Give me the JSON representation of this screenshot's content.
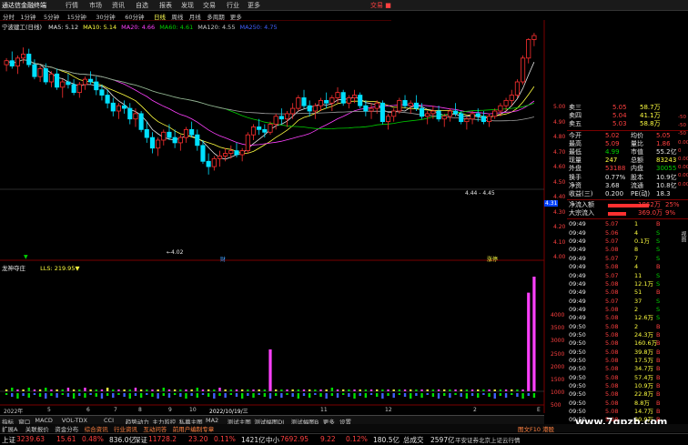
{
  "app": {
    "logo": "通达信金融终端",
    "trade_label": "交易 ■"
  },
  "menu": [
    "行情",
    "市场",
    "资讯",
    "自选",
    "报表",
    "发现",
    "交易",
    "行业",
    "更多"
  ],
  "periods": [
    {
      "label": "分时",
      "active": false
    },
    {
      "label": "1分钟",
      "active": false
    },
    {
      "label": "5分钟",
      "active": false
    },
    {
      "label": "15分钟",
      "active": false
    },
    {
      "label": "30分钟",
      "active": false
    },
    {
      "label": "60分钟",
      "active": false
    },
    {
      "label": "日线",
      "active": true
    },
    {
      "label": "周线",
      "active": false
    },
    {
      "label": "月线",
      "active": false
    },
    {
      "label": "多周期",
      "active": false
    },
    {
      "label": "更多",
      "active": false
    }
  ],
  "chart_legend": {
    "stock": "宁波建工(日线)",
    "items": [
      {
        "text": "MA5: 5.12",
        "color": "#e6e6e6"
      },
      {
        "text": "MA10: 5.14",
        "color": "#ffff40"
      },
      {
        "text": "MA20: 4.66",
        "color": "#ff40ff"
      },
      {
        "text": "MA60: 4.61",
        "color": "#00d000"
      },
      {
        "text": "MA120: 4.55",
        "color": "#c8c8c8"
      },
      {
        "text": "MA250: 4.75",
        "color": "#4060ff"
      }
    ]
  },
  "annotations": {
    "low_label": "←4.02",
    "range_label": "4.44 - 4.45",
    "marker_low": "▼",
    "marker_cai": "财",
    "marker_zhang": "涨停"
  },
  "price_axis": [
    "5.00",
    "4.90",
    "4.80",
    "4.70",
    "4.60",
    "4.50",
    "4.40",
    "4.30",
    "4.20",
    "4.10",
    "4.00"
  ],
  "price_tag": "4.31",
  "indicator": {
    "name": "龙神夺庄",
    "value": "LLS: 219.95▼"
  },
  "indicator_axis": [
    "4000",
    "3500",
    "3000",
    "2500",
    "2000",
    "1500",
    "1000",
    "500"
  ],
  "date_axis": [
    {
      "label": "2022年",
      "color": "#c8c8c8"
    },
    {
      "label": "5",
      "color": "#c8c8c8"
    },
    {
      "label": "6",
      "color": "#c8c8c8"
    },
    {
      "label": "7",
      "color": "#c8c8c8"
    },
    {
      "label": "8",
      "color": "#c8c8c8"
    },
    {
      "label": "9",
      "color": "#c8c8c8"
    },
    {
      "label": "10",
      "color": "#c8c8c8"
    },
    {
      "label": "2022/10/19/三",
      "color": "#ffffff"
    },
    {
      "label": "11",
      "color": "#c8c8c8"
    },
    {
      "label": "12",
      "color": "#c8c8c8"
    },
    {
      "label": "2",
      "color": "#c8c8c8"
    },
    {
      "label": "E",
      "color": "#c8c8c8"
    }
  ],
  "order_book": [
    {
      "label": "卖三",
      "price": "5.05",
      "vol": "58.7万",
      "pclass": "red"
    },
    {
      "label": "卖四",
      "price": "5.04",
      "vol": "41.1万",
      "pclass": "red"
    },
    {
      "label": "卖五",
      "price": "5.03",
      "vol": "58.8万",
      "pclass": "red"
    }
  ],
  "quote": [
    {
      "l1": "今开",
      "v1": "5.02",
      "c1": "red",
      "l2": "均价",
      "v2": "5.05",
      "c2": "red"
    },
    {
      "l1": "最高",
      "v1": "5.09",
      "c1": "red",
      "l2": "量比",
      "v2": "1.86",
      "c2": "red"
    },
    {
      "l1": "最低",
      "v1": "4.99",
      "c1": "green",
      "l2": "市值",
      "v2": "55.2亿",
      "c2": "white"
    },
    {
      "l1": "现量",
      "v1": "247",
      "c1": "yellow",
      "l2": "总额",
      "v2": "83243",
      "c2": "yellow"
    },
    {
      "l1": "外盘",
      "v1": "53188",
      "c1": "red",
      "l2": "内盘",
      "v2": "30055",
      "c2": "green"
    },
    {
      "l1": "换手",
      "v1": "0.77%",
      "c1": "white",
      "l2": "股本",
      "v2": "10.9亿",
      "c2": "white"
    },
    {
      "l1": "净资",
      "v1": "3.68",
      "c1": "white",
      "l2": "流通",
      "v2": "10.8亿",
      "c2": "white"
    },
    {
      "l1": "收益(三)",
      "v1": "0.200",
      "c1": "white",
      "l2": "PE(动)",
      "v2": "18.3",
      "c2": "white"
    }
  ],
  "flows": [
    {
      "label": "净流入额",
      "value": "1862万",
      "pct": "25%"
    },
    {
      "label": "大宗流入",
      "value": "369.0万",
      "pct": "9%"
    }
  ],
  "ticks": [
    {
      "t": "09:49",
      "p": "5.07",
      "v": "1",
      "s": "B",
      "pc": "red",
      "sc": "red"
    },
    {
      "t": "09:49",
      "p": "5.06",
      "v": "4",
      "s": "S",
      "pc": "red",
      "sc": "green"
    },
    {
      "t": "09:49",
      "p": "5.07",
      "v": "0.1万",
      "s": "S",
      "pc": "red",
      "sc": "green"
    },
    {
      "t": "09:49",
      "p": "5.08",
      "v": "8",
      "s": "S",
      "pc": "red",
      "sc": "green"
    },
    {
      "t": "09:49",
      "p": "5.07",
      "v": "7",
      "s": "S",
      "pc": "red",
      "sc": "green"
    },
    {
      "t": "09:49",
      "p": "5.08",
      "v": "4",
      "s": "B",
      "pc": "red",
      "sc": "red"
    },
    {
      "t": "09:49",
      "p": "5.07",
      "v": "11",
      "s": "S",
      "pc": "red",
      "sc": "green"
    },
    {
      "t": "09:49",
      "p": "5.08",
      "v": "12.1万",
      "s": "S",
      "pc": "red",
      "sc": "green"
    },
    {
      "t": "09:49",
      "p": "5.08",
      "v": "51",
      "s": "B",
      "pc": "red",
      "sc": "red"
    },
    {
      "t": "09:49",
      "p": "5.07",
      "v": "37",
      "s": "S",
      "pc": "red",
      "sc": "green"
    },
    {
      "t": "09:49",
      "p": "5.08",
      "v": "2",
      "s": "S",
      "pc": "red",
      "sc": "green"
    },
    {
      "t": "09:49",
      "p": "5.08",
      "v": "12.6万",
      "s": "S",
      "pc": "red",
      "sc": "green"
    },
    {
      "t": "09:50",
      "p": "5.08",
      "v": "2",
      "s": "B",
      "pc": "red",
      "sc": "red"
    },
    {
      "t": "09:50",
      "p": "5.08",
      "v": "24.3万",
      "s": "B",
      "pc": "red",
      "sc": "red"
    },
    {
      "t": "09:50",
      "p": "5.08",
      "v": "160.6万",
      "s": "B",
      "pc": "red",
      "sc": "red"
    },
    {
      "t": "09:50",
      "p": "5.08",
      "v": "39.8万",
      "s": "B",
      "pc": "red",
      "sc": "red"
    },
    {
      "t": "09:50",
      "p": "5.08",
      "v": "17.5万",
      "s": "B",
      "pc": "red",
      "sc": "red"
    },
    {
      "t": "09:50",
      "p": "5.08",
      "v": "34.7万",
      "s": "B",
      "pc": "red",
      "sc": "red"
    },
    {
      "t": "09:50",
      "p": "5.08",
      "v": "57.4万",
      "s": "B",
      "pc": "red",
      "sc": "red"
    },
    {
      "t": "09:50",
      "p": "5.08",
      "v": "10.9万",
      "s": "B",
      "pc": "red",
      "sc": "red"
    },
    {
      "t": "09:50",
      "p": "5.08",
      "v": "22.8万",
      "s": "B",
      "pc": "red",
      "sc": "red"
    },
    {
      "t": "09:50",
      "p": "5.08",
      "v": "8.8万",
      "s": "B",
      "pc": "red",
      "sc": "red"
    },
    {
      "t": "09:50",
      "p": "5.08",
      "v": "14.7万",
      "s": "B",
      "pc": "red",
      "sc": "red"
    },
    {
      "t": "09:50",
      "p": "5.08",
      "v": "20.9万",
      "s": "B",
      "pc": "red",
      "sc": "red"
    }
  ],
  "right_edge": [
    "-50",
    "-50",
    "-50",
    "0.00%",
    "0",
    "0.00",
    "0.00",
    "0.00",
    "0.00"
  ],
  "bottom_tabs": [
    "指标",
    "窗口",
    "MACD",
    "VOL-TDX",
    "CCI",
    "趋势动力",
    "主力监控",
    "私募主图",
    "MA2",
    "测试主图",
    "测试幅图DI",
    "测试幅图B",
    "更多",
    "设置"
  ],
  "link_tabs": [
    "扩展A",
    "关联报价",
    "资金分布",
    "综合资讯",
    "行业资讯",
    "互动问答",
    "前用户编制专章"
  ],
  "link_right": "图文F10 港股",
  "status": [
    {
      "name": "上证",
      "val": "3239.63",
      "chg": "15.61",
      "pct": "0.48%",
      "amt": "836.0亿"
    },
    {
      "name": "深证",
      "val": "11728.2",
      "chg": "23.20",
      "pct": "0.11%",
      "amt": "1421亿"
    },
    {
      "name": "中小",
      "val": "7692.95",
      "chg": "9.22",
      "pct": "0.12%",
      "amt": "180.5亿"
    }
  ],
  "status_tail": {
    "label": "总成交",
    "amt": "2597亿",
    "note": "平安证券北京上证云行情"
  },
  "watermark": "www.7gpzb.com",
  "side_tab": "视图",
  "chart_data": {
    "type": "candlestick",
    "ylim": [
      3.95,
      5.05
    ],
    "candles": [
      [
        4.85,
        4.9,
        4.8,
        4.88
      ],
      [
        4.88,
        4.95,
        4.82,
        4.84
      ],
      [
        4.84,
        4.92,
        4.78,
        4.9
      ],
      [
        4.9,
        4.98,
        4.86,
        4.93
      ],
      [
        4.93,
        4.97,
        4.83,
        4.85
      ],
      [
        4.85,
        4.89,
        4.74,
        4.76
      ],
      [
        4.76,
        4.84,
        4.72,
        4.82
      ],
      [
        4.82,
        4.86,
        4.7,
        4.72
      ],
      [
        4.72,
        4.8,
        4.68,
        4.78
      ],
      [
        4.78,
        4.82,
        4.66,
        4.68
      ],
      [
        4.68,
        4.74,
        4.6,
        4.72
      ],
      [
        4.72,
        4.78,
        4.67,
        4.7
      ],
      [
        4.7,
        4.74,
        4.62,
        4.64
      ],
      [
        4.64,
        4.72,
        4.6,
        4.7
      ],
      [
        4.7,
        4.76,
        4.66,
        4.74
      ],
      [
        4.74,
        4.8,
        4.7,
        4.72
      ],
      [
        4.72,
        4.76,
        4.62,
        4.66
      ],
      [
        4.66,
        4.7,
        4.58,
        4.62
      ],
      [
        4.62,
        4.66,
        4.52,
        4.56
      ],
      [
        4.56,
        4.6,
        4.46,
        4.5
      ],
      [
        4.5,
        4.56,
        4.44,
        4.54
      ],
      [
        4.54,
        4.58,
        4.48,
        4.52
      ],
      [
        4.52,
        4.56,
        4.4,
        4.44
      ],
      [
        4.44,
        4.52,
        4.38,
        4.48
      ],
      [
        4.48,
        4.5,
        4.34,
        4.36
      ],
      [
        4.36,
        4.42,
        4.26,
        4.3
      ],
      [
        4.3,
        4.34,
        4.18,
        4.22
      ],
      [
        4.22,
        4.3,
        4.16,
        4.28
      ],
      [
        4.28,
        4.36,
        4.24,
        4.34
      ],
      [
        4.34,
        4.4,
        4.28,
        4.3
      ],
      [
        4.3,
        4.36,
        4.22,
        4.26
      ],
      [
        4.26,
        4.32,
        4.2,
        4.3
      ],
      [
        4.3,
        4.38,
        4.26,
        4.36
      ],
      [
        4.36,
        4.42,
        4.3,
        4.32
      ],
      [
        4.32,
        4.36,
        4.2,
        4.24
      ],
      [
        4.24,
        4.28,
        4.1,
        4.12
      ],
      [
        4.12,
        4.18,
        4.02,
        4.08
      ],
      [
        4.08,
        4.16,
        4.05,
        4.14
      ],
      [
        4.14,
        4.2,
        4.08,
        4.16
      ],
      [
        4.16,
        4.22,
        4.12,
        4.18
      ],
      [
        4.18,
        4.24,
        4.14,
        4.2
      ],
      [
        4.2,
        4.26,
        4.15,
        4.17
      ],
      [
        4.17,
        4.22,
        4.12,
        4.2
      ],
      [
        4.2,
        4.34,
        4.18,
        4.32
      ],
      [
        4.32,
        4.4,
        4.28,
        4.38
      ],
      [
        4.38,
        4.44,
        4.32,
        4.36
      ],
      [
        4.36,
        4.4,
        4.3,
        4.34
      ],
      [
        4.34,
        4.42,
        4.32,
        4.4
      ],
      [
        4.4,
        4.48,
        4.36,
        4.46
      ],
      [
        4.46,
        4.52,
        4.4,
        4.44
      ],
      [
        4.44,
        4.5,
        4.38,
        4.48
      ],
      [
        4.48,
        4.56,
        4.44,
        4.52
      ],
      [
        4.52,
        4.62,
        4.5,
        4.6
      ],
      [
        4.6,
        4.66,
        4.52,
        4.54
      ],
      [
        4.54,
        4.58,
        4.46,
        4.5
      ],
      [
        4.5,
        4.56,
        4.44,
        4.54
      ],
      [
        4.54,
        4.6,
        4.5,
        4.58
      ],
      [
        4.58,
        4.64,
        4.52,
        4.56
      ],
      [
        4.56,
        4.62,
        4.5,
        4.6
      ],
      [
        4.6,
        4.68,
        4.56,
        4.64
      ],
      [
        4.64,
        4.66,
        4.54,
        4.56
      ],
      [
        4.56,
        4.62,
        4.52,
        4.6
      ],
      [
        4.6,
        4.66,
        4.56,
        4.62
      ],
      [
        4.62,
        4.64,
        4.52,
        4.54
      ],
      [
        4.54,
        4.58,
        4.46,
        4.5
      ],
      [
        4.5,
        4.56,
        4.44,
        4.52
      ],
      [
        4.52,
        4.58,
        4.48,
        4.56
      ],
      [
        4.56,
        4.58,
        4.4,
        4.42
      ],
      [
        4.42,
        4.48,
        4.36,
        4.46
      ],
      [
        4.46,
        4.52,
        4.42,
        4.5
      ],
      [
        4.5,
        4.6,
        4.48,
        4.58
      ],
      [
        4.58,
        4.62,
        4.52,
        4.54
      ],
      [
        4.54,
        4.58,
        4.48,
        4.56
      ],
      [
        4.56,
        4.62,
        4.5,
        4.52
      ],
      [
        4.52,
        4.56,
        4.44,
        4.46
      ],
      [
        4.46,
        4.5,
        4.4,
        4.48
      ],
      [
        4.48,
        4.54,
        4.44,
        4.5
      ],
      [
        4.5,
        4.54,
        4.42,
        4.44
      ],
      [
        4.44,
        4.48,
        4.38,
        4.46
      ],
      [
        4.46,
        4.52,
        4.42,
        4.5
      ],
      [
        4.5,
        4.56,
        4.46,
        4.48
      ],
      [
        4.48,
        4.5,
        4.4,
        4.42
      ],
      [
        4.42,
        4.46,
        4.36,
        4.44
      ],
      [
        4.44,
        4.5,
        4.4,
        4.48
      ],
      [
        4.48,
        4.52,
        4.42,
        4.46
      ],
      [
        4.46,
        4.5,
        4.4,
        4.42
      ],
      [
        4.42,
        4.48,
        4.38,
        4.46
      ],
      [
        4.46,
        4.52,
        4.44,
        4.5
      ],
      [
        4.5,
        4.56,
        4.46,
        4.54
      ],
      [
        4.54,
        4.6,
        4.5,
        4.58
      ],
      [
        4.58,
        4.66,
        4.54,
        4.62
      ],
      [
        4.62,
        4.74,
        4.6,
        4.72
      ],
      [
        4.72,
        4.92,
        4.7,
        4.9
      ],
      [
        4.9,
        5.05,
        4.86,
        5.04
      ],
      [
        5.04,
        5.09,
        4.99,
        5.07
      ]
    ],
    "volume": [
      1,
      2,
      1,
      1,
      2,
      1,
      1,
      2,
      1,
      1,
      1,
      2,
      1,
      1,
      2,
      1,
      1,
      1,
      2,
      1,
      1,
      1,
      1,
      2,
      1,
      1,
      1,
      1,
      2,
      1,
      1,
      1,
      1,
      1,
      2,
      1,
      1,
      1,
      2,
      1,
      1,
      1,
      1,
      1,
      1,
      1,
      1,
      9,
      1,
      1,
      1,
      1,
      1,
      1,
      1,
      1,
      1,
      1,
      2,
      1,
      1,
      1,
      1,
      1,
      1,
      1,
      1,
      1,
      1,
      1,
      1,
      1,
      1,
      1,
      1,
      1,
      1,
      1,
      1,
      1,
      1,
      1,
      1,
      1,
      1,
      1,
      1,
      1,
      1,
      1,
      1,
      1,
      1,
      1,
      1
    ],
    "indicator_spikes": [
      {
        "index": 47,
        "value": 1700
      },
      {
        "index": 93,
        "value": 4000
      },
      {
        "index": 94,
        "value": 4650
      }
    ]
  }
}
